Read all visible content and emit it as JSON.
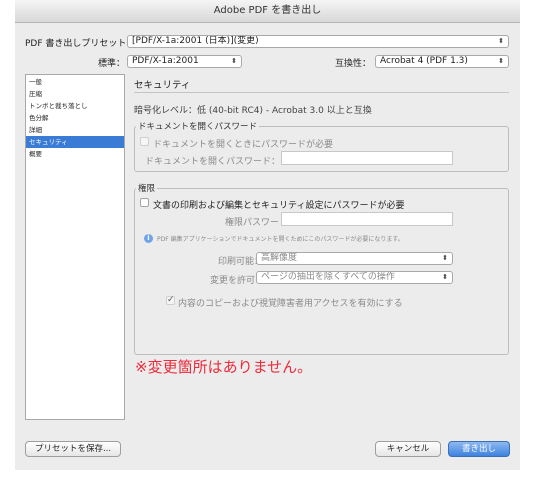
{
  "window": {
    "title": "Adobe PDF を書き出し"
  },
  "preset": {
    "label": "PDF 書き出しプリセット：",
    "value": "[PDF/X-1a:2001 (日本)](変更)"
  },
  "standard": {
    "label": "標準：",
    "value": "PDF/X-1a:2001"
  },
  "compat": {
    "label": "互換性：",
    "value": "Acrobat 4 (PDF 1.3)"
  },
  "sidebar": {
    "items": [
      {
        "label": "一般"
      },
      {
        "label": "圧縮"
      },
      {
        "label": "トンボと裁ち落とし"
      },
      {
        "label": "色分解"
      },
      {
        "label": "詳細"
      },
      {
        "label": "セキュリティ"
      },
      {
        "label": "概要"
      }
    ],
    "selected": 5
  },
  "security": {
    "title": "セキュリティ",
    "encryption": "暗号化レベル：低 (40-bit RC4) - Acrobat 3.0 以上と互換",
    "open_group": {
      "legend": "ドキュメントを開くパスワード",
      "checkbox": "ドキュメントを開くときにパスワードが必要",
      "field_label": "ドキュメントを開くパスワード："
    },
    "perm_group": {
      "legend": "権限",
      "checkbox": "文書の印刷および編集とセキュリティ設定にパスワードが必要",
      "field_label": "権限パスワード：",
      "info": "PDF 編集アプリケーションでドキュメントを開くためにこのパスワードが必要になります。",
      "print_label": "印刷可能：",
      "print_value": "高解像度",
      "change_label": "変更を許可：",
      "change_value": "ページの抽出を除くすべての操作",
      "copy_checkbox": "内容のコピーおよび視覚障害者用アクセスを有効にする"
    }
  },
  "notice": "※変更箇所はありません。",
  "buttons": {
    "save_preset": "プリセットを保存...",
    "cancel": "キャンセル",
    "export": "書き出し"
  },
  "colors": {
    "accent": "#3a7bd5",
    "notice": "#ee2b3a"
  }
}
